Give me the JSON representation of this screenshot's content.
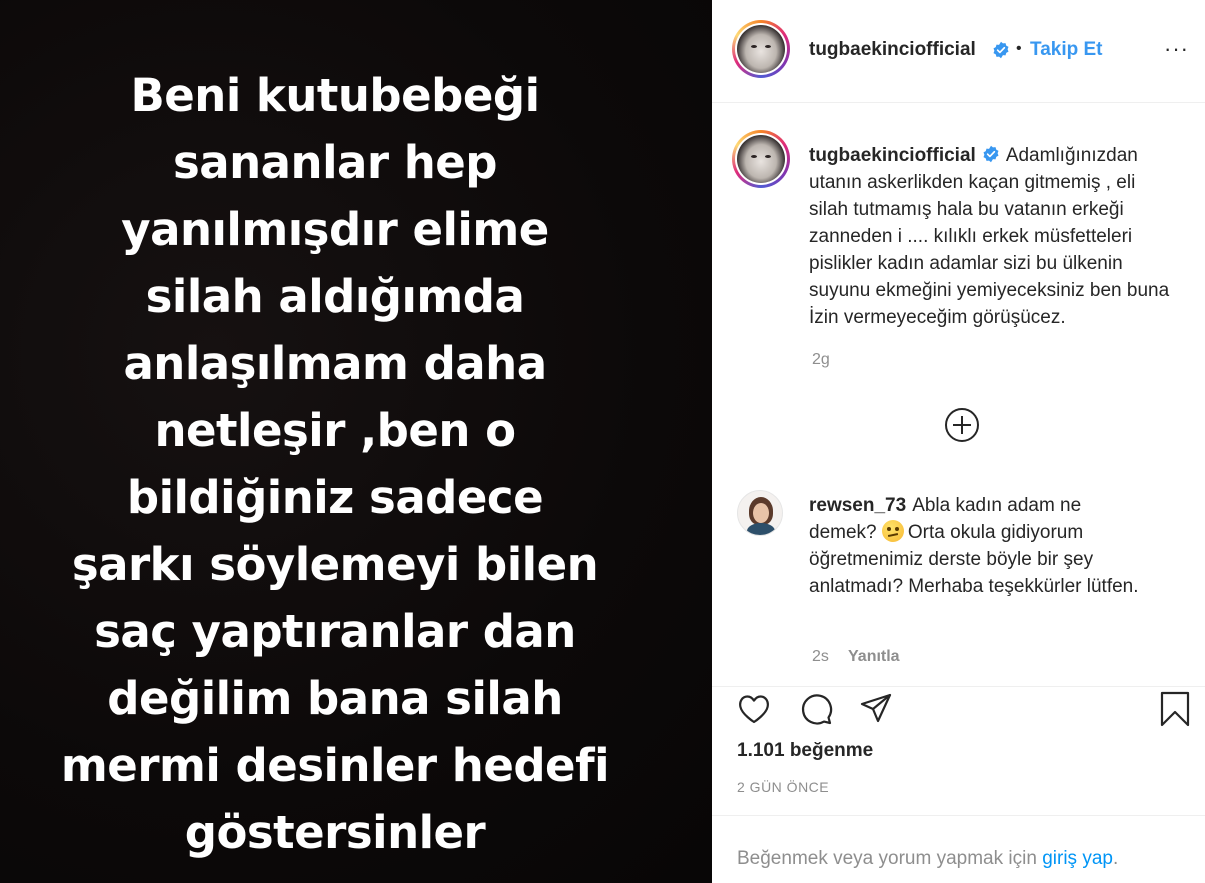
{
  "post": {
    "story_lines": [
      "Beni kutubebeği",
      "sananlar hep",
      "yanılmışdır elime",
      "silah aldığımda",
      "anlaşılmam daha",
      "netleşir ,ben o",
      "bildiğiniz sadece",
      "şarkı söylemeyi bilen",
      "saç yaptıranlar dan",
      "değilim bana silah",
      "mermi desinler hedefi",
      "göstersinler"
    ]
  },
  "header": {
    "username": "tugbaekinciofficial",
    "separator": "•",
    "follow_label": "Takip Et",
    "more_label": "···",
    "avatar_icon": "profile-avatar",
    "verified_icon": "verified-badge-icon",
    "verified_color": "#3897f0"
  },
  "caption": {
    "username": "tugbaekinciofficial",
    "text": "Adamlığınızdan utanın askerlikden kaçan gitmemiş , eli silah tutmamış hala bu vatanın erkeği zanneden i .... kılıklı erkek müsfetteleri pislikler kadın adamlar sizi bu ülkenin suyunu ekmeğini yemiyeceksiniz ben buna İzin vermeyeceğim görüşücez.",
    "time": "2g"
  },
  "load_more_icon": "plus-circle-icon",
  "comment": {
    "username": "rewsen_73",
    "text_before_emoji": "Abla kadın adam ne demek?",
    "emoji": "thinking-face-emoji",
    "text_after_emoji": "Orta okula gidiyorum öğretmenimiz derste böyle bir şey anlatmadı? Merhaba teşekkürler lütfen.",
    "time": "2s",
    "reply_label": "Yanıtla"
  },
  "actions": {
    "like_icon": "heart-icon",
    "comment_icon": "comment-icon",
    "share_icon": "share-icon",
    "save_icon": "bookmark-icon"
  },
  "likes": "1.101 beğenme",
  "posted_ago": "2 GÜN ÖNCE",
  "login_prompt": {
    "text": "Beğenmek veya yorum yapmak için",
    "link": "giriş yap",
    "suffix": ".",
    "link_color": "#0095f6"
  }
}
